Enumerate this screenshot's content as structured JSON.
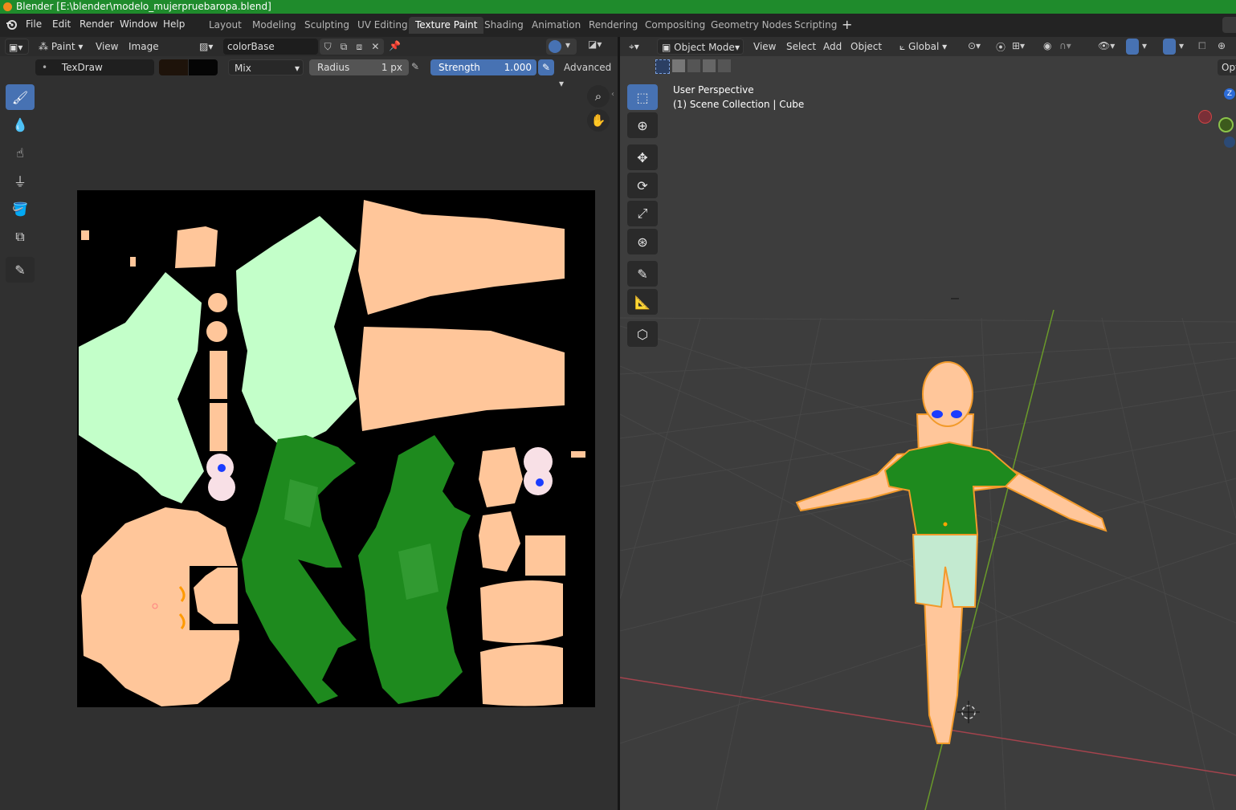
{
  "window": {
    "title": "Blender [E:\\blender\\modelo_mujerpruebaropa.blend]"
  },
  "menu": {
    "items": [
      "File",
      "Edit",
      "Render",
      "Window",
      "Help"
    ],
    "workspaces": [
      "Layout",
      "Modeling",
      "Sculpting",
      "UV Editing",
      "Texture Paint",
      "Shading",
      "Animation",
      "Rendering",
      "Compositing",
      "Geometry Nodes",
      "Scripting"
    ],
    "add_tab": "+"
  },
  "image_editor": {
    "header": {
      "mode": "Paint",
      "view": "View",
      "image": "Image",
      "image_name": "colorBase"
    },
    "tool_header": {
      "brush_name": "TexDraw",
      "blend_mode": "Mix",
      "radius_label": "Radius",
      "radius_value": "1 px",
      "strength_label": "Strength",
      "strength_value": "1.000",
      "advanced": "Advanced"
    },
    "tools": [
      "brush-icon",
      "blur-drop-icon",
      "smear-icon",
      "clone-stamp-icon",
      "fill-bucket-icon",
      "mask-icon",
      "annotate-icon"
    ]
  },
  "viewport": {
    "header": {
      "mode": "Object Mode",
      "view": "View",
      "select": "Select",
      "add": "Add",
      "object": "Object",
      "orientation": "Global",
      "options": "Opt"
    },
    "overlay": {
      "perspective": "User Perspective",
      "collection": "(1) Scene Collection | Cube"
    },
    "gizmo_axis": "Z"
  },
  "colors": {
    "accent": "#4772b3",
    "titlebar": "#1f8b2c",
    "skin": "#ffc69a",
    "shirt": "#1e8a1e",
    "shorts": "#c3ffc9"
  }
}
